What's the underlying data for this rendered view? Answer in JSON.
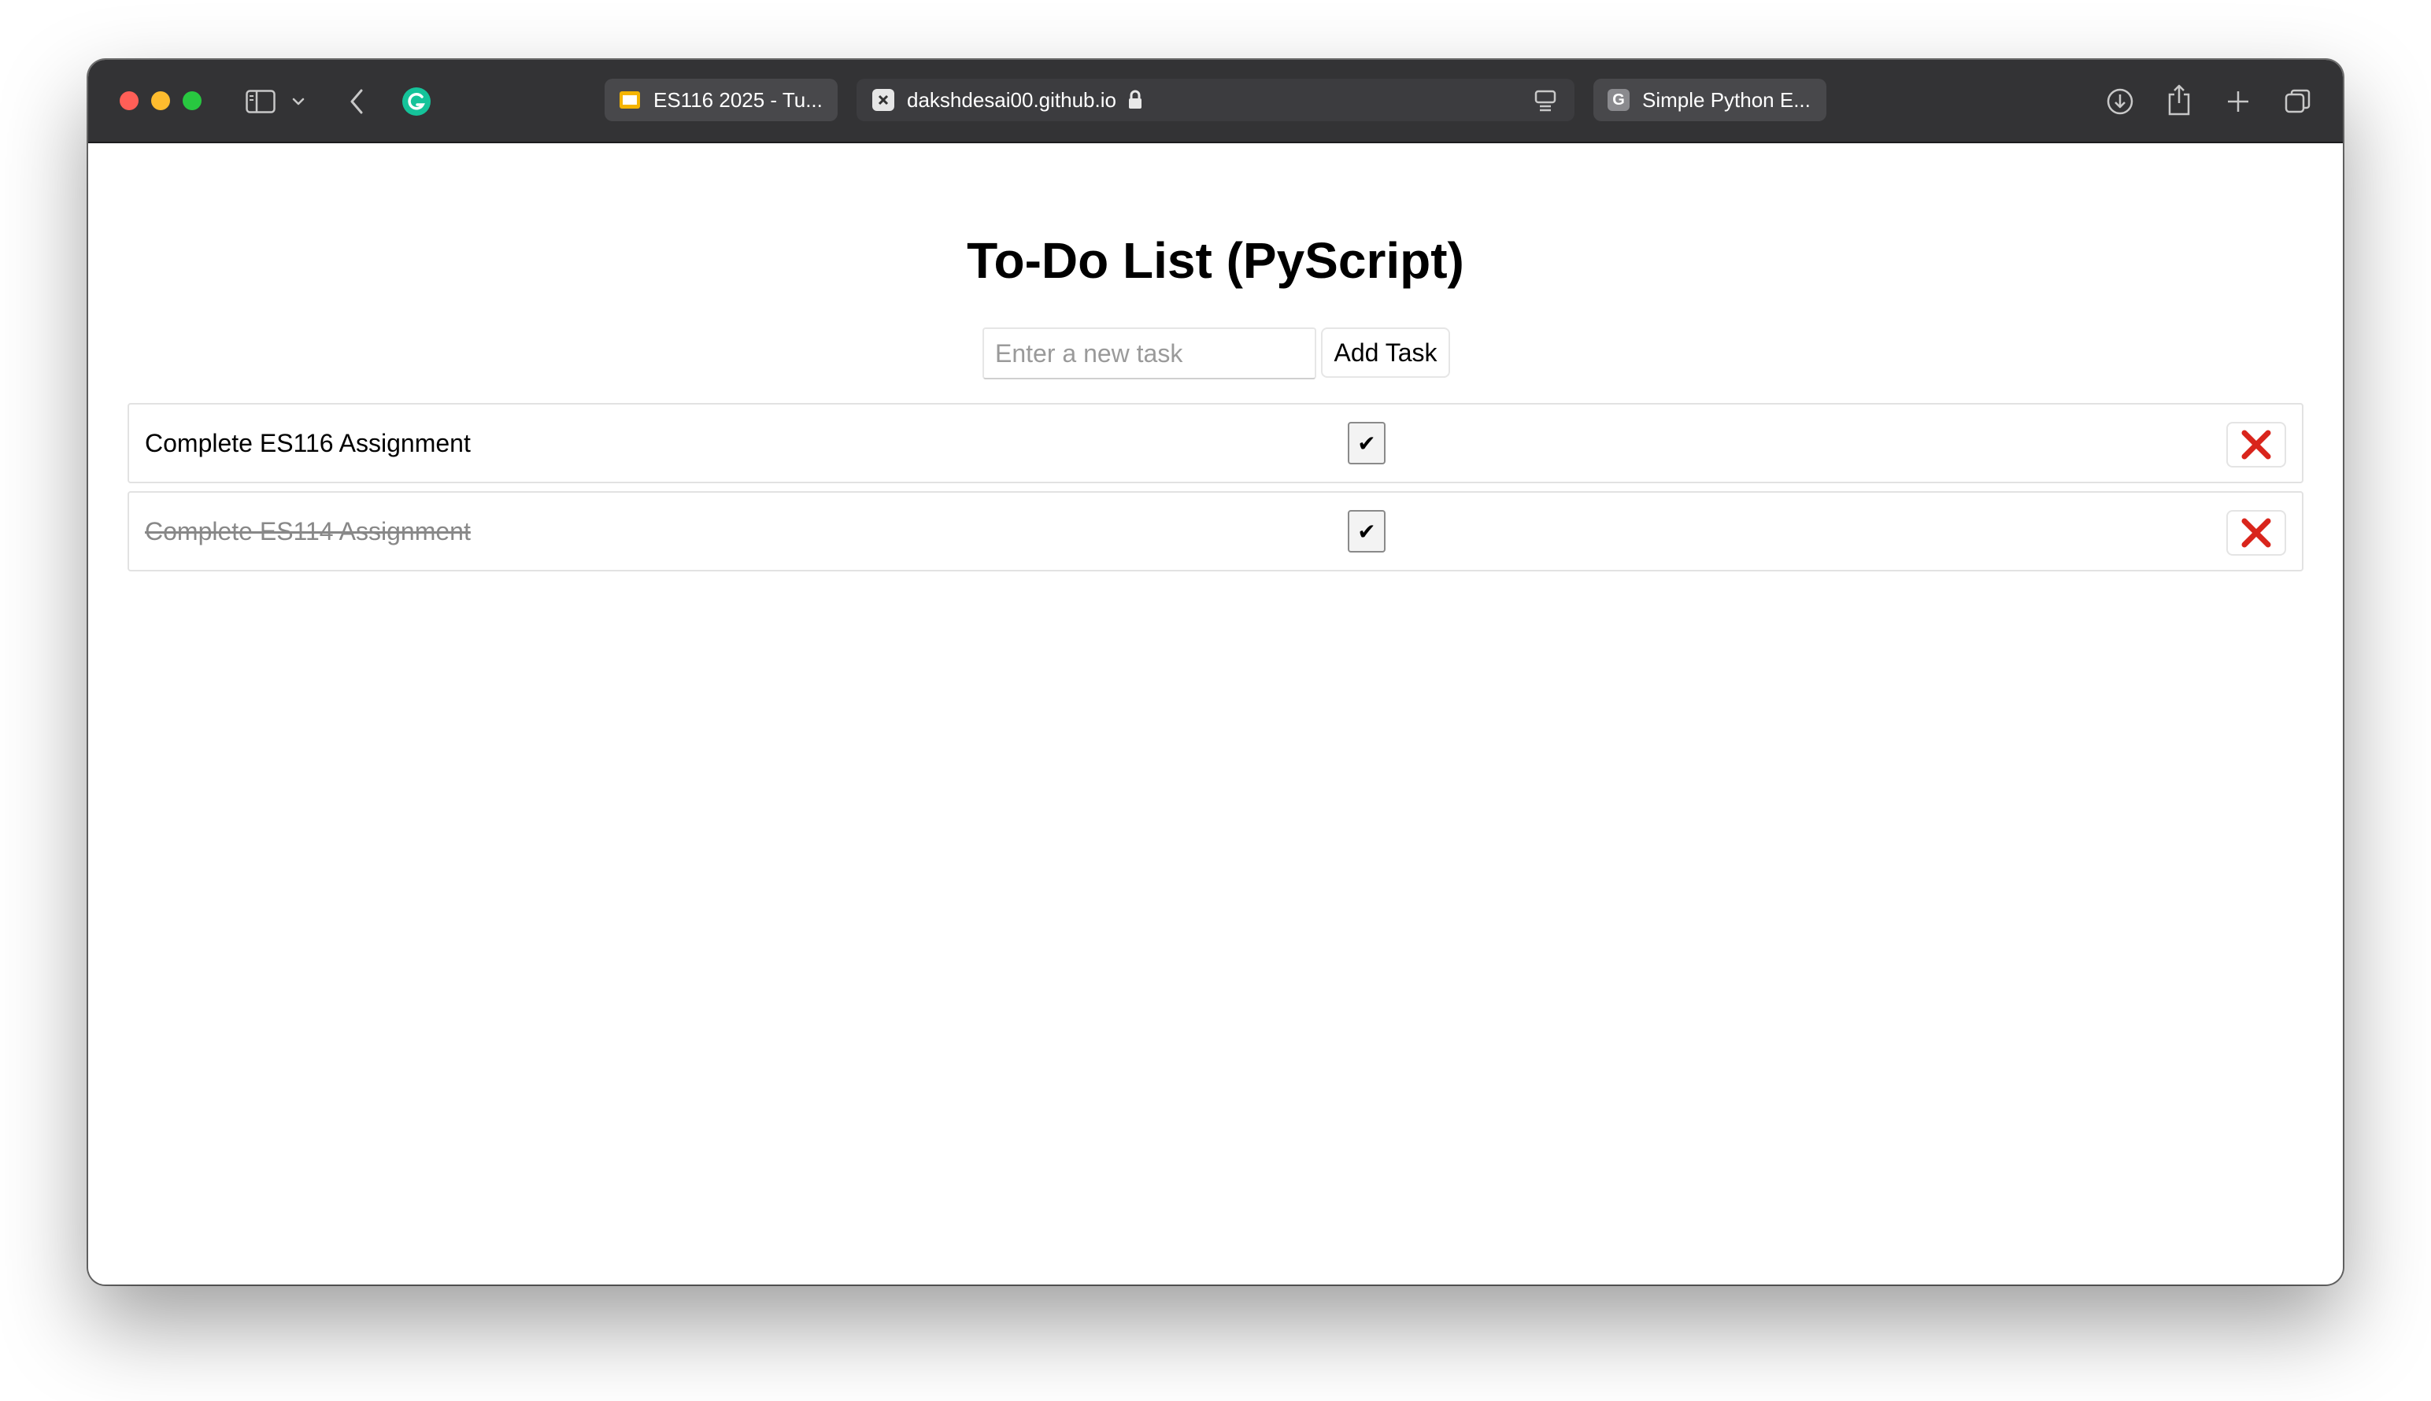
{
  "browser": {
    "tabs": [
      {
        "label": "ES116 2025 - Tu...",
        "favicon": "slides-icon",
        "state": "inactive"
      },
      {
        "label": "dakshdesai00.github.io",
        "favicon": "x-box-icon",
        "state": "active",
        "secure": true
      },
      {
        "label": "Simple Python E...",
        "favicon": "G",
        "state": "inactive"
      }
    ]
  },
  "page": {
    "title": "To-Do List (PyScript)",
    "input": {
      "placeholder": "Enter a new task",
      "value": ""
    },
    "add_button": "Add Task",
    "tasks": [
      {
        "text": "Complete ES116 Assignment",
        "completed": false,
        "check_symbol": "✔"
      },
      {
        "text": "Complete ES114 Assignment",
        "completed": true,
        "check_symbol": "✔"
      }
    ]
  },
  "colors": {
    "toolbar": "#333335",
    "delete_x": "#d9251c",
    "completed_text": "#888888"
  }
}
